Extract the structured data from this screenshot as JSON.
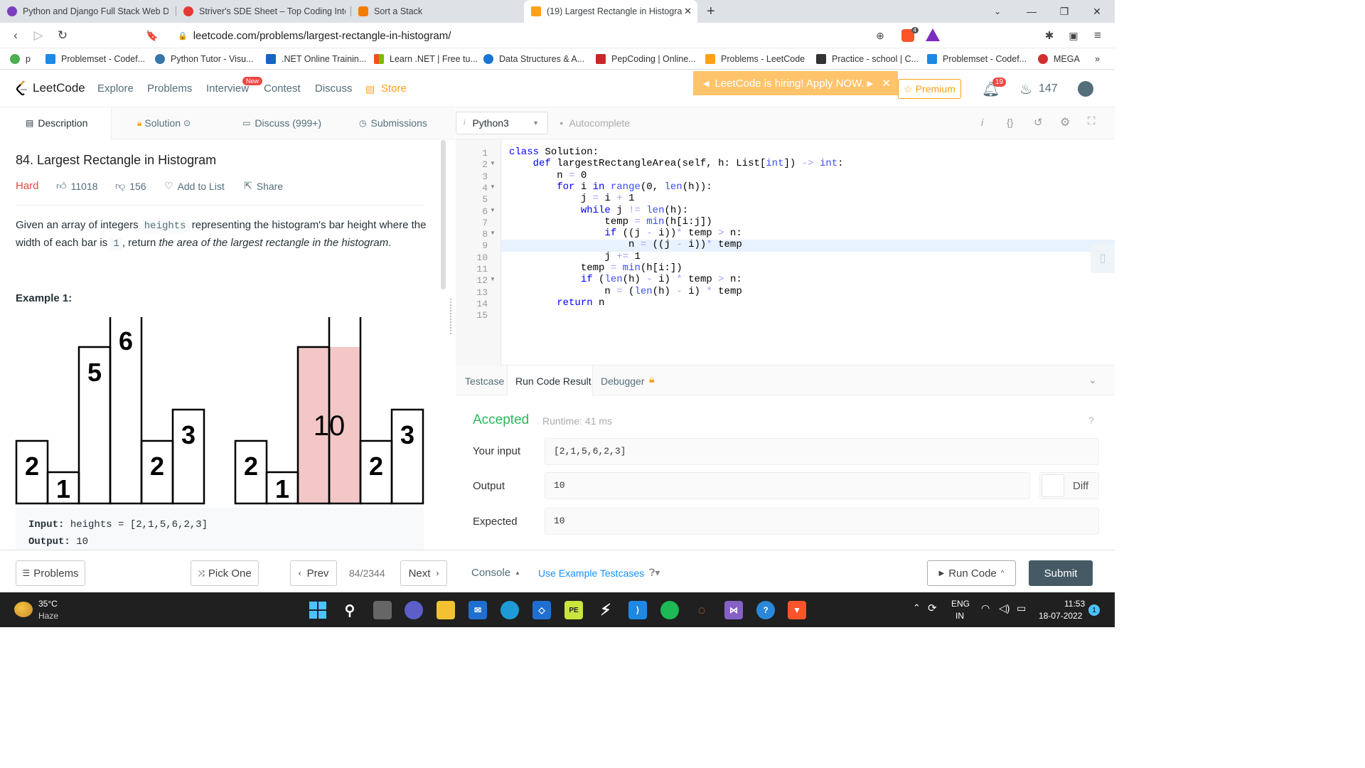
{
  "browser": {
    "tabs": [
      {
        "title": "Python and Django Full Stack Web De",
        "color": "#7b3fbe"
      },
      {
        "title": "Striver's SDE Sheet – Top Coding Inter",
        "color": "#e53935"
      },
      {
        "title": "Sort a Stack",
        "color": "#f57c00"
      },
      {
        "title": "(19) Largest Rectangle in Histogra",
        "color": "#ffa116"
      }
    ],
    "url": "leetcode.com/problems/largest-rectangle-in-histogram/",
    "extension_badge": "4",
    "bookmarks": [
      {
        "label": "p",
        "color": "#4caf50"
      },
      {
        "label": "Problemset - Codef...",
        "color": "#1e88e5"
      },
      {
        "label": "Python Tutor - Visu...",
        "color": "#3776ab"
      },
      {
        "label": ".NET Online Trainin...",
        "color": "#1565c0"
      },
      {
        "label": "Learn .NET | Free tu...",
        "color": "#f25022"
      },
      {
        "label": "Data Structures & A...",
        "color": "#1976d2"
      },
      {
        "label": "PepCoding | Online...",
        "color": "#c62828"
      },
      {
        "label": "Problems - LeetCode",
        "color": "#ffa116"
      },
      {
        "label": "Practice - school | C...",
        "color": "#333333"
      },
      {
        "label": "Problemset - Codef...",
        "color": "#1e88e5"
      },
      {
        "label": "MEGA",
        "color": "#d32f2f"
      }
    ]
  },
  "nav": {
    "brand": "LeetCode",
    "links": [
      "Explore",
      "Problems",
      "Interview",
      "Contest",
      "Discuss",
      "Store"
    ],
    "new_badge": "New",
    "banner": "LeetCode is hiring! Apply NOW.",
    "premium": "Premium",
    "notifications": "19",
    "streak": "147"
  },
  "panel_tabs": [
    "Description",
    "Solution",
    "Discuss (999+)",
    "Submissions"
  ],
  "problem": {
    "title": "84. Largest Rectangle in Histogram",
    "difficulty": "Hard",
    "likes": "11018",
    "dislikes": "156",
    "add_to_list": "Add to List",
    "share": "Share",
    "desc_1": "Given an array of integers",
    "desc_code_1": "heights",
    "desc_2": "representing the histogram's bar height where the width of each bar is",
    "desc_code_2": "1",
    "desc_3": ", return",
    "desc_em": "the area of the largest rectangle in the histogram",
    "desc_4": ".",
    "example_title": "Example 1:",
    "heights": [
      2,
      1,
      5,
      6,
      2,
      3
    ],
    "answer_label": "10",
    "highlight_color": "#f4c7c7",
    "example_input_label": "Input:",
    "example_input_value": "heights = [2,1,5,6,2,3]",
    "example_output_label": "Output:",
    "example_output_value": "10"
  },
  "editor": {
    "language": "Python3",
    "autocomplete": "Autocomplete",
    "lines": [
      "1",
      "2",
      "3",
      "4",
      "5",
      "6",
      "7",
      "8",
      "9",
      "10",
      "11",
      "12",
      "13",
      "14",
      "15"
    ],
    "code": [
      "class Solution:",
      "    def largestRectangleArea(self, h: List[int]) -> int:",
      "        n = 0",
      "        for i in range(0, len(h)):",
      "            j = i + 1",
      "            while j != len(h):",
      "                temp = min(h[i:j])",
      "                if ((j - i))* temp > n:",
      "                    n = ((j - i))* temp",
      "                j += 1",
      "            temp = min(h[i:])",
      "            if (len(h) - i) * temp > n:",
      "                n = (len(h) - i) * temp",
      "        return n",
      ""
    ]
  },
  "console": {
    "tabs": [
      "Testcase",
      "Run Code Result",
      "Debugger"
    ],
    "status": "Accepted",
    "runtime": "Runtime: 41 ms",
    "input_label": "Your input",
    "input_value": "[2,1,5,6,2,3]",
    "output_label": "Output",
    "output_value": "10",
    "expected_label": "Expected",
    "expected_value": "10",
    "diff_label": "Diff"
  },
  "bottom": {
    "problems": "Problems",
    "pick_one": "Pick One",
    "prev": "Prev",
    "counter": "84/2344",
    "next": "Next",
    "console": "Console",
    "use_example": "Use Example Testcases",
    "run_code": "Run Code",
    "submit": "Submit"
  },
  "taskbar": {
    "temp": "35°C",
    "weather": "Haze",
    "lang_1": "ENG",
    "lang_2": "IN",
    "time": "11:53",
    "date": "18-07-2022",
    "notif_count": "1"
  },
  "colors": {
    "accent": "#ffa116",
    "accepted": "#2db55d",
    "hard": "#ef4743",
    "submit": "#455a64"
  }
}
